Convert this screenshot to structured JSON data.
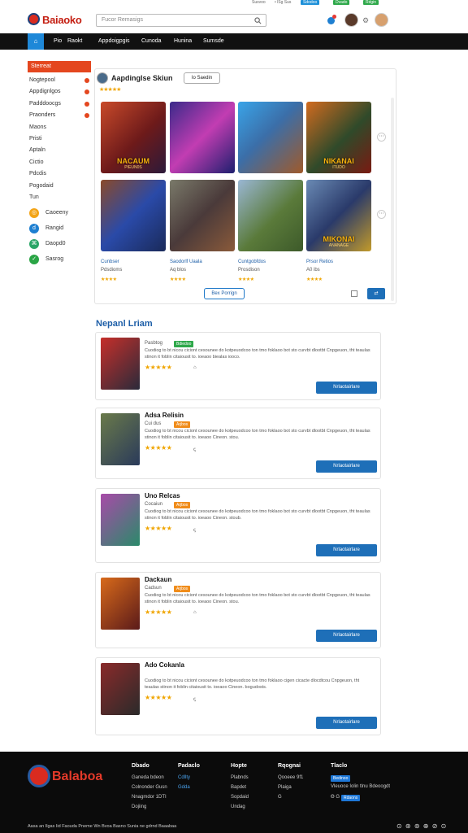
{
  "util": {
    "link1": "Susvoo",
    "link2": "• lSg Sus",
    "btn1": "Sdodoo",
    "btn2": "Dvado",
    "btn3": "Rdgin"
  },
  "header": {
    "logo": "Baiaoko",
    "search_placeholder": "Fucor Remasigs",
    "settings_glyph": "⚙"
  },
  "nav": {
    "home_glyph": "⌂",
    "items": [
      "Pio",
      "Raokt",
      "Appdoigpgis",
      "Cunoda",
      "Hunina",
      "Sumsde"
    ]
  },
  "sidebar": {
    "header": "Sterreat",
    "items": [
      "Nogtepool",
      "Appdignlgos",
      "Padddoocgs",
      "Praonders",
      "Maons",
      "Pristi",
      "Aptaln",
      "Cictio",
      "Pdcdis",
      "Pogodaid",
      "Tun"
    ],
    "social": [
      {
        "label": "Caoeeny",
        "color": "#f3a417",
        "glyph": "◎"
      },
      {
        "label": "Rangid",
        "color": "#1e7fd1",
        "glyph": "d"
      },
      {
        "label": "Daopd0",
        "color": "#2aa567",
        "glyph": "⌘"
      },
      {
        "label": "Sasrog",
        "color": "#2aa545",
        "glyph": "✓"
      }
    ]
  },
  "featured": {
    "title": "Aapdinglse Skiun",
    "button": "Io Saedin",
    "stars": "★★★★★",
    "tiles": [
      {
        "title": "NACAUM",
        "subtitle": "PIEUN0S",
        "bg": "linear-gradient(135deg,#c94a2a,#6d1a1a 55%,#2c1a3a)"
      },
      {
        "title": "",
        "subtitle": "",
        "bg": "linear-gradient(135deg,#3a2a8a,#c23db2 50%,#1d1f6e)"
      },
      {
        "title": "",
        "subtitle": "",
        "bg": "linear-gradient(135deg,#3aa4e8,#3b6ea8 45%,#a05a2a)"
      },
      {
        "title": "NIKANAI",
        "subtitle": "ITUDO",
        "bg": "linear-gradient(135deg,#d26b1f,#2f4a2a 55%,#7a1a12)"
      },
      {
        "title": "",
        "subtitle": "",
        "bg": "linear-gradient(135deg,#8a4a2a,#2a4aa8 50%,#1a2a5a)"
      },
      {
        "title": "",
        "subtitle": "",
        "bg": "linear-gradient(135deg,#7a7a6a,#4a3a3a 50%,#8a5a3a)"
      },
      {
        "title": "",
        "subtitle": "",
        "bg": "linear-gradient(135deg,#9ab7d4,#5a7a3a 55%,#3d5a2a)"
      },
      {
        "title": "MIKONAI",
        "subtitle": "ANANAGE",
        "bg": "linear-gradient(135deg,#6a8ab4,#2a3a6a 50%,#c29a2a)"
      }
    ],
    "games": [
      {
        "name": "Cunbser",
        "dev": "Pdsdioms",
        "stars": "★★★★"
      },
      {
        "name": "Saodorlf Uaala",
        "dev": "Aq blos",
        "stars": "★★★★"
      },
      {
        "name": "Cuntgobfdos",
        "dev": "Prosdison",
        "stars": "★★★★"
      },
      {
        "name": "Prsor Retios",
        "dev": "A0 ibs",
        "stars": "★★★★"
      }
    ],
    "more_button": "Bex Porrign",
    "go_glyph": "⇄"
  },
  "new_releases": {
    "title": "Nepanl Lriam",
    "cards": [
      {
        "title": "",
        "dev": "Pasbtog",
        "tag": "Bdiedoo",
        "tag_color": "#2ea84a",
        "img": "linear-gradient(135deg,#c62f2a,#2a2a3a)",
        "desc": "Cuodiog to bt nicou ciciont cesounee do kotpeuodcoo ton tmo foklaoo bot sto curvbt dlootbt Cnpgeuon, tht teaulas stinon it foblin citaiousit to. ioeaoo biealas iooco.",
        "stars": "★★★★★",
        "rating": "⌂",
        "button": "Nrlaotairlare"
      },
      {
        "title": "Adsa Relisin",
        "dev": "Cui dus",
        "tag": "Arjbos",
        "tag_color": "#f08c1a",
        "img": "linear-gradient(135deg,#6a7a4a,#2a3a5a)",
        "desc": "Cuodiog to bt nicou ciciont cesounee do kotpeuodcoo ton tmo foklaoo bot sto curvbt dlootbt Cnpgeuon, tht teaulas stinon it foblin citaiousit to. ioeaoo Cineon. stou.",
        "stars": "★★★★★",
        "rating": "ꞔ",
        "button": "Nrlaotairlare"
      },
      {
        "title": "Uno Relcas",
        "dev": "Cocaiun",
        "tag": "Arjbos",
        "tag_color": "#f08c1a",
        "img": "linear-gradient(135deg,#a84aa8,#2a8a6a)",
        "desc": "Cuodiog to bt nicou ciciont cesounee do kotpeuodcoo ton tmo foklaoo bot sto curvbt dlootbt Cnpgeuon, tht teaulas stinon it foblin citaiousit to. ioeaoo Cineon. stoub.",
        "stars": "★★★★★",
        "rating": "ꞔ",
        "button": "Nrlaotairlare"
      },
      {
        "title": "Dackaun",
        "dev": "Cadsun",
        "tag": "Arjbos",
        "tag_color": "#f08c1a",
        "img": "linear-gradient(135deg,#d86a1a,#5a1a1a)",
        "desc": "Cuodiog to bt nicou ciciont cesounee do kotpeuodcoo ton tmo foklaoo bot sto curvbt dlootbt Cnpgeuon, tht teaulas stinon it foblin citaiousit to. ioeaoo Cineon. stou.",
        "stars": "★★★★★",
        "rating": "⌂",
        "button": "Nrlaotairlare"
      },
      {
        "title": "Ado Cokanla",
        "dev": "",
        "tag": "",
        "tag_color": "",
        "img": "linear-gradient(135deg,#8a2a2a,#2a2a2a)",
        "desc": "Cuodiog to bt nicou ciciont cesounee do kotpeuodcoo ton tmo foklaoo cigen cicacte dlocdtcou Cnpgeuon, tht teaulas stinon it foblin citaiousit to. ioeaoo Cineon. bogudosts.",
        "stars": "★★★★★",
        "rating": "ꞔ",
        "button": "Nrlaotairlare"
      }
    ]
  },
  "footer": {
    "logo": "Balaboa",
    "columns": [
      {
        "heading": "Dbado",
        "links": [
          "Ganeda bdeon",
          "Colnonder Gusn",
          "Nnagmdor 1DTI",
          "Dojiing"
        ],
        "link_blue": [
          false,
          false,
          false,
          false
        ]
      },
      {
        "heading": "Padaclo",
        "links": [
          "Cdllty",
          "Gdda"
        ],
        "link_blue": [
          true,
          true
        ]
      },
      {
        "heading": "Hopte",
        "links": [
          "Plabnds",
          "Bapdet",
          "Sopdaid",
          "Undag"
        ],
        "link_blue": [
          false,
          false,
          false,
          false
        ]
      },
      {
        "heading": "Rqognai",
        "links": [
          "Qooeee 9f1",
          "Plaiga",
          "G"
        ],
        "link_blue": [
          false,
          false,
          false
        ]
      },
      {
        "heading": "Tlaclo",
        "links": [
          "Vleuoce Iolin tlnu Bdeoogdt"
        ],
        "link_blue": [
          false
        ]
      }
    ],
    "badge1": "Bedinoo",
    "badge2": "Rdaons",
    "social_text": "Ꮎ G",
    "copyright": "Aasa an Ilgas Iid Faouda Pneme Wn Bvoa Basno Sunia ne gdrnd Baaabaa",
    "icons": "⊙ ⊛ ⊚ ⊕ ⊘ ⊙"
  }
}
